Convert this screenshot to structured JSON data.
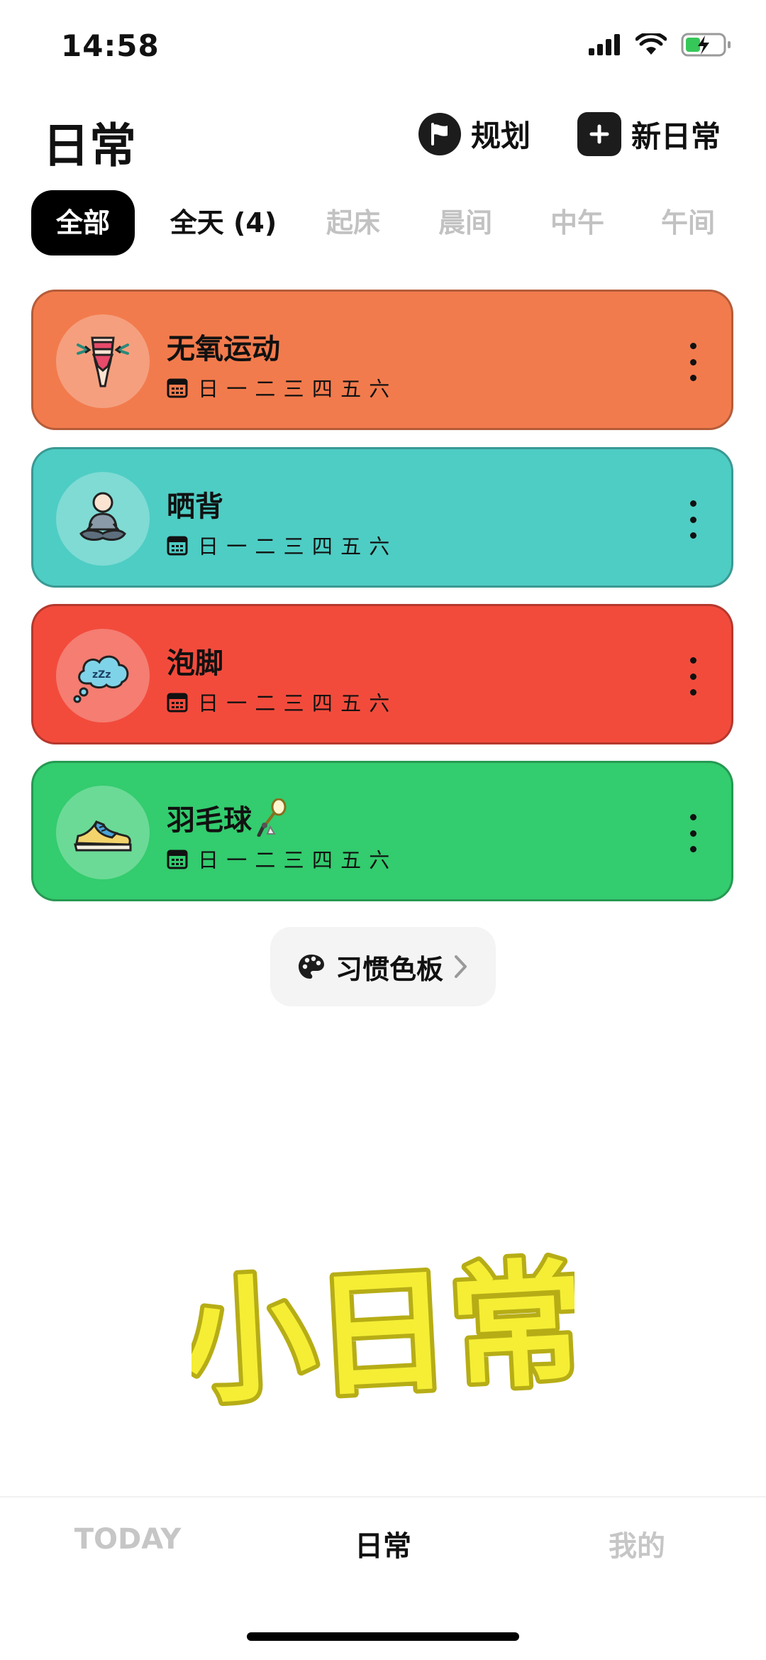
{
  "status_bar": {
    "time": "14:58"
  },
  "header": {
    "title": "日常",
    "plan_label": "规划",
    "new_label": "新日常"
  },
  "tabs": [
    "全部",
    "全天 (4)",
    "起床",
    "晨间",
    "中午",
    "午间"
  ],
  "routines": [
    {
      "name": "无氧运动",
      "days": "日 一 二 三 四 五 六",
      "color": "#f27b4d",
      "icon": "fitness-body-icon"
    },
    {
      "name": "晒背",
      "days": "日 一 二 三 四 五 六",
      "color": "#4ecdc4",
      "icon": "meditation-person-icon"
    },
    {
      "name": "泡脚",
      "days": "日 一 二 三 四 五 六",
      "color": "#f24b3c",
      "icon": "sleep-cloud-icon"
    },
    {
      "name": "羽毛球",
      "emoji": "🏸",
      "days": "日 一 二 三 四 五 六",
      "color": "#33cc6e",
      "icon": "sneaker-icon"
    }
  ],
  "palette_button": {
    "label": "习惯色板"
  },
  "logo_text": "小日常",
  "bottom_nav": [
    "TODAY",
    "日常",
    "我的"
  ],
  "colors": {
    "logo_fill": "#f5ee35",
    "logo_stroke": "#b6ad16",
    "tab_inactive": "#c2c2c2"
  }
}
